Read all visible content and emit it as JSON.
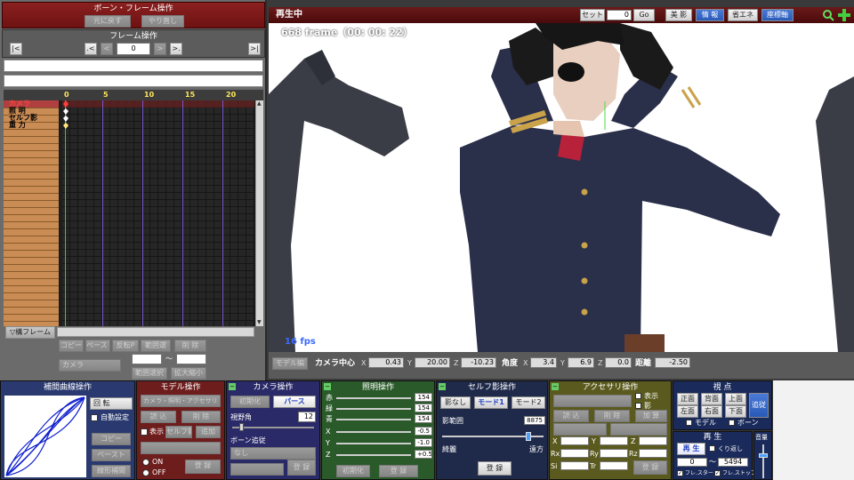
{
  "bone_frame": {
    "title": "ボーン・フレーム操作",
    "undo": "元に戻す",
    "redo": "やり直し"
  },
  "frame_op": {
    "title": "フレーム操作",
    "frame_value": "0",
    "btn_first": "|<",
    "btn_prev_key": ".<",
    "btn_prev": "<",
    "btn_next": ">",
    "btn_next_key": ">.",
    "btn_last": ">|"
  },
  "timeline": {
    "ticks": [
      "0",
      "5",
      "10",
      "15",
      "20"
    ],
    "tracks": [
      "カメラ",
      "照 明",
      "セルフ影",
      "重 力"
    ]
  },
  "left_bottom": {
    "expand_frame": "▽構フレーム",
    "copy": "コピー",
    "paste": "ペースト",
    "reverse_paste": "反転P",
    "vertical_select": "範囲選",
    "delete": "削 除",
    "camera_select": "カメラ",
    "range_select": "範囲選択",
    "scale": "拡大縮小",
    "tilde": "～"
  },
  "viewport": {
    "status": "再生中",
    "set_label": "セット",
    "set_value": "0",
    "go": "Go",
    "beauty": "美 影",
    "info": "情 報",
    "energy": "省エネ",
    "axis": "座標軸",
    "frame_info": "668 frame（00: 00: 22）",
    "fps": "16 fps"
  },
  "camera_center": {
    "model_edit": "モデル編",
    "label": "カメラ中心",
    "x_label": "X",
    "x": "0.43",
    "y_label": "Y",
    "y": "20.00",
    "z_label": "Z",
    "z": "-10.23",
    "angle_label": "角度",
    "ax_label": "X",
    "ax": "3.4",
    "ay_label": "Y",
    "ay": "6.9",
    "az_label": "Z",
    "az": "0.0",
    "dist_label": "距離",
    "dist": "-2.50"
  },
  "interp": {
    "title": "補間曲線操作",
    "rotate": "回 転",
    "auto": "自動設定",
    "copy": "コピー",
    "paste": "ペースト",
    "linear": "線形補間"
  },
  "model_op": {
    "title": "モデル操作",
    "model": "カメラ・照明・アクセサリ",
    "load": "読 込",
    "delete": "削 除",
    "show": "表示",
    "self_shadow": "セルフ影",
    "add": "追加",
    "on": "ON",
    "off": "OFF",
    "register": "登 録"
  },
  "camera_op": {
    "title": "カメラ操作",
    "init": "初期化",
    "perspective": "パース",
    "fov_label": "視野角",
    "fov": "12",
    "bone_follow": "ボーン追従",
    "none": "なし",
    "register": "登 録"
  },
  "light_op": {
    "title": "照明操作",
    "r_label": "赤",
    "r": "154",
    "g_label": "緑",
    "g": "154",
    "b_label": "青",
    "b": "154",
    "x_label": "X",
    "x": "-0.5",
    "y_label": "Y",
    "y": "-1.0",
    "z_label": "Z",
    "z": "+0.5",
    "init": "初期化",
    "register": "登 録"
  },
  "self_shadow": {
    "title": "セルフ影操作",
    "none": "影なし",
    "mode1": "モード1",
    "mode2": "モード2",
    "range_label": "影範囲",
    "range": "8875",
    "near": "綺麗",
    "far": "遠方",
    "register": "登 録"
  },
  "accessory": {
    "title": "アクセサリ操作",
    "show": "表示",
    "shadow": "影",
    "load": "読 込",
    "delete": "削 除",
    "add": "加 算",
    "x": "X",
    "y": "Y",
    "z": "Z",
    "rx": "Rx",
    "ry": "Ry",
    "rz": "Rz",
    "si": "Si",
    "tr": "Tr",
    "register": "登 録"
  },
  "view_panel": {
    "title": "視 点",
    "front": "正面",
    "back": "背面",
    "top": "上面",
    "follow": "追従",
    "left": "左面",
    "right": "右面",
    "bottom": "下面",
    "model": "モデル",
    "bone": "ボーン"
  },
  "play_panel": {
    "title": "再 生",
    "play": "再 生",
    "repeat": "くり返し",
    "from": "0",
    "to": "5494",
    "tilde": "～",
    "frame_start": "フレ.スタート",
    "frame_stop": "フレ.ストップ",
    "volume": "音量"
  }
}
